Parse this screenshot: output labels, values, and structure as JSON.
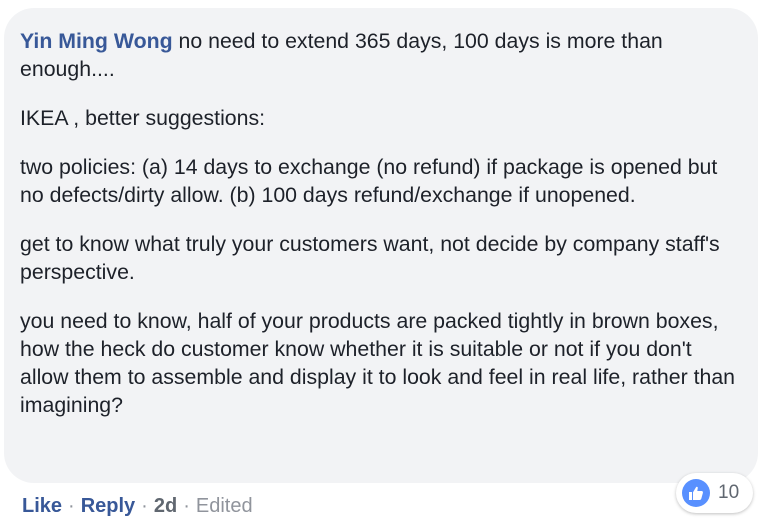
{
  "comment": {
    "author": "Yin Ming Wong",
    "first_line_text": " no need to extend 365 days, 100 days is more than enough....",
    "paragraphs": [
      "IKEA , better suggestions:",
      "two policies: (a) 14 days to exchange (no refund) if package is opened but no defects/dirty allow. (b) 100 days refund/exchange if unopened.",
      "get to know what truly your customers want, not decide by company staff's perspective.",
      "you need to know, half of your products are packed tightly in brown boxes, how the heck do customer know whether it is suitable or not if you don't allow them to assemble and display it to look and feel in real life, rather than imagining?"
    ]
  },
  "actions": {
    "like_label": "Like",
    "reply_label": "Reply",
    "separator": "·",
    "timestamp": "2d",
    "edited_label": "Edited"
  },
  "reactions": {
    "icon": "like-thumbs-up-icon",
    "count": "10"
  },
  "colors": {
    "bubble_bg": "#f2f3f5",
    "author_link": "#385898",
    "body_text": "#1d2129",
    "meta_text": "#606770",
    "like_icon_bg": "#5890ff"
  }
}
